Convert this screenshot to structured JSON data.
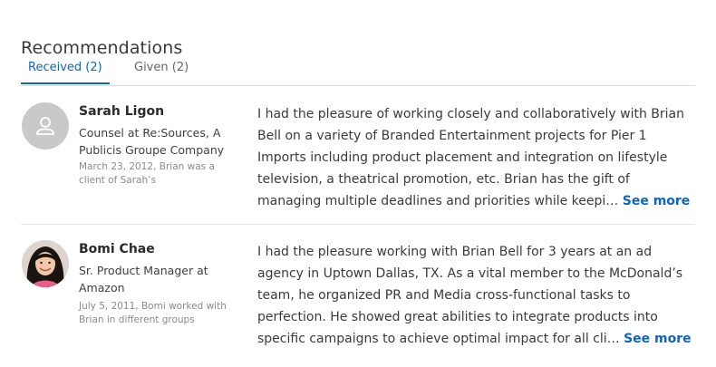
{
  "section_title": "Recommendations",
  "tabs": [
    {
      "label": "Received (2)"
    },
    {
      "label": "Given (2)"
    }
  ],
  "see_more_label": "See more",
  "recommendations": [
    {
      "name": "Sarah Ligon",
      "headline": "Counsel at Re:Sources, A Publicis Groupe Company",
      "meta": "March 23, 2012, Brian was a client of Sarah’s",
      "text": "I had the pleasure of working closely and collaboratively with Brian Bell on a variety of Branded Entertainment projects for Pier 1 Imports including product placement and integration on lifestyle television, a theatrical promotion, etc. Brian has the gift of managing multiple deadlines and priorities while keepi…"
    },
    {
      "name": "Bomi Chae",
      "headline": "Sr. Product Manager at Amazon",
      "meta": "July 5, 2011, Bomi worked with Brian in different groups",
      "text": "I had the pleasure working with Brian Bell for 3 years at an ad agency in Uptown Dallas, TX. As a vital member to the McDonald’s team, he organized PR and Media cross-functional tasks to perfection. He showed great abilities to integrate products into specific campaigns to achieve optimal impact for all cli…"
    }
  ]
}
